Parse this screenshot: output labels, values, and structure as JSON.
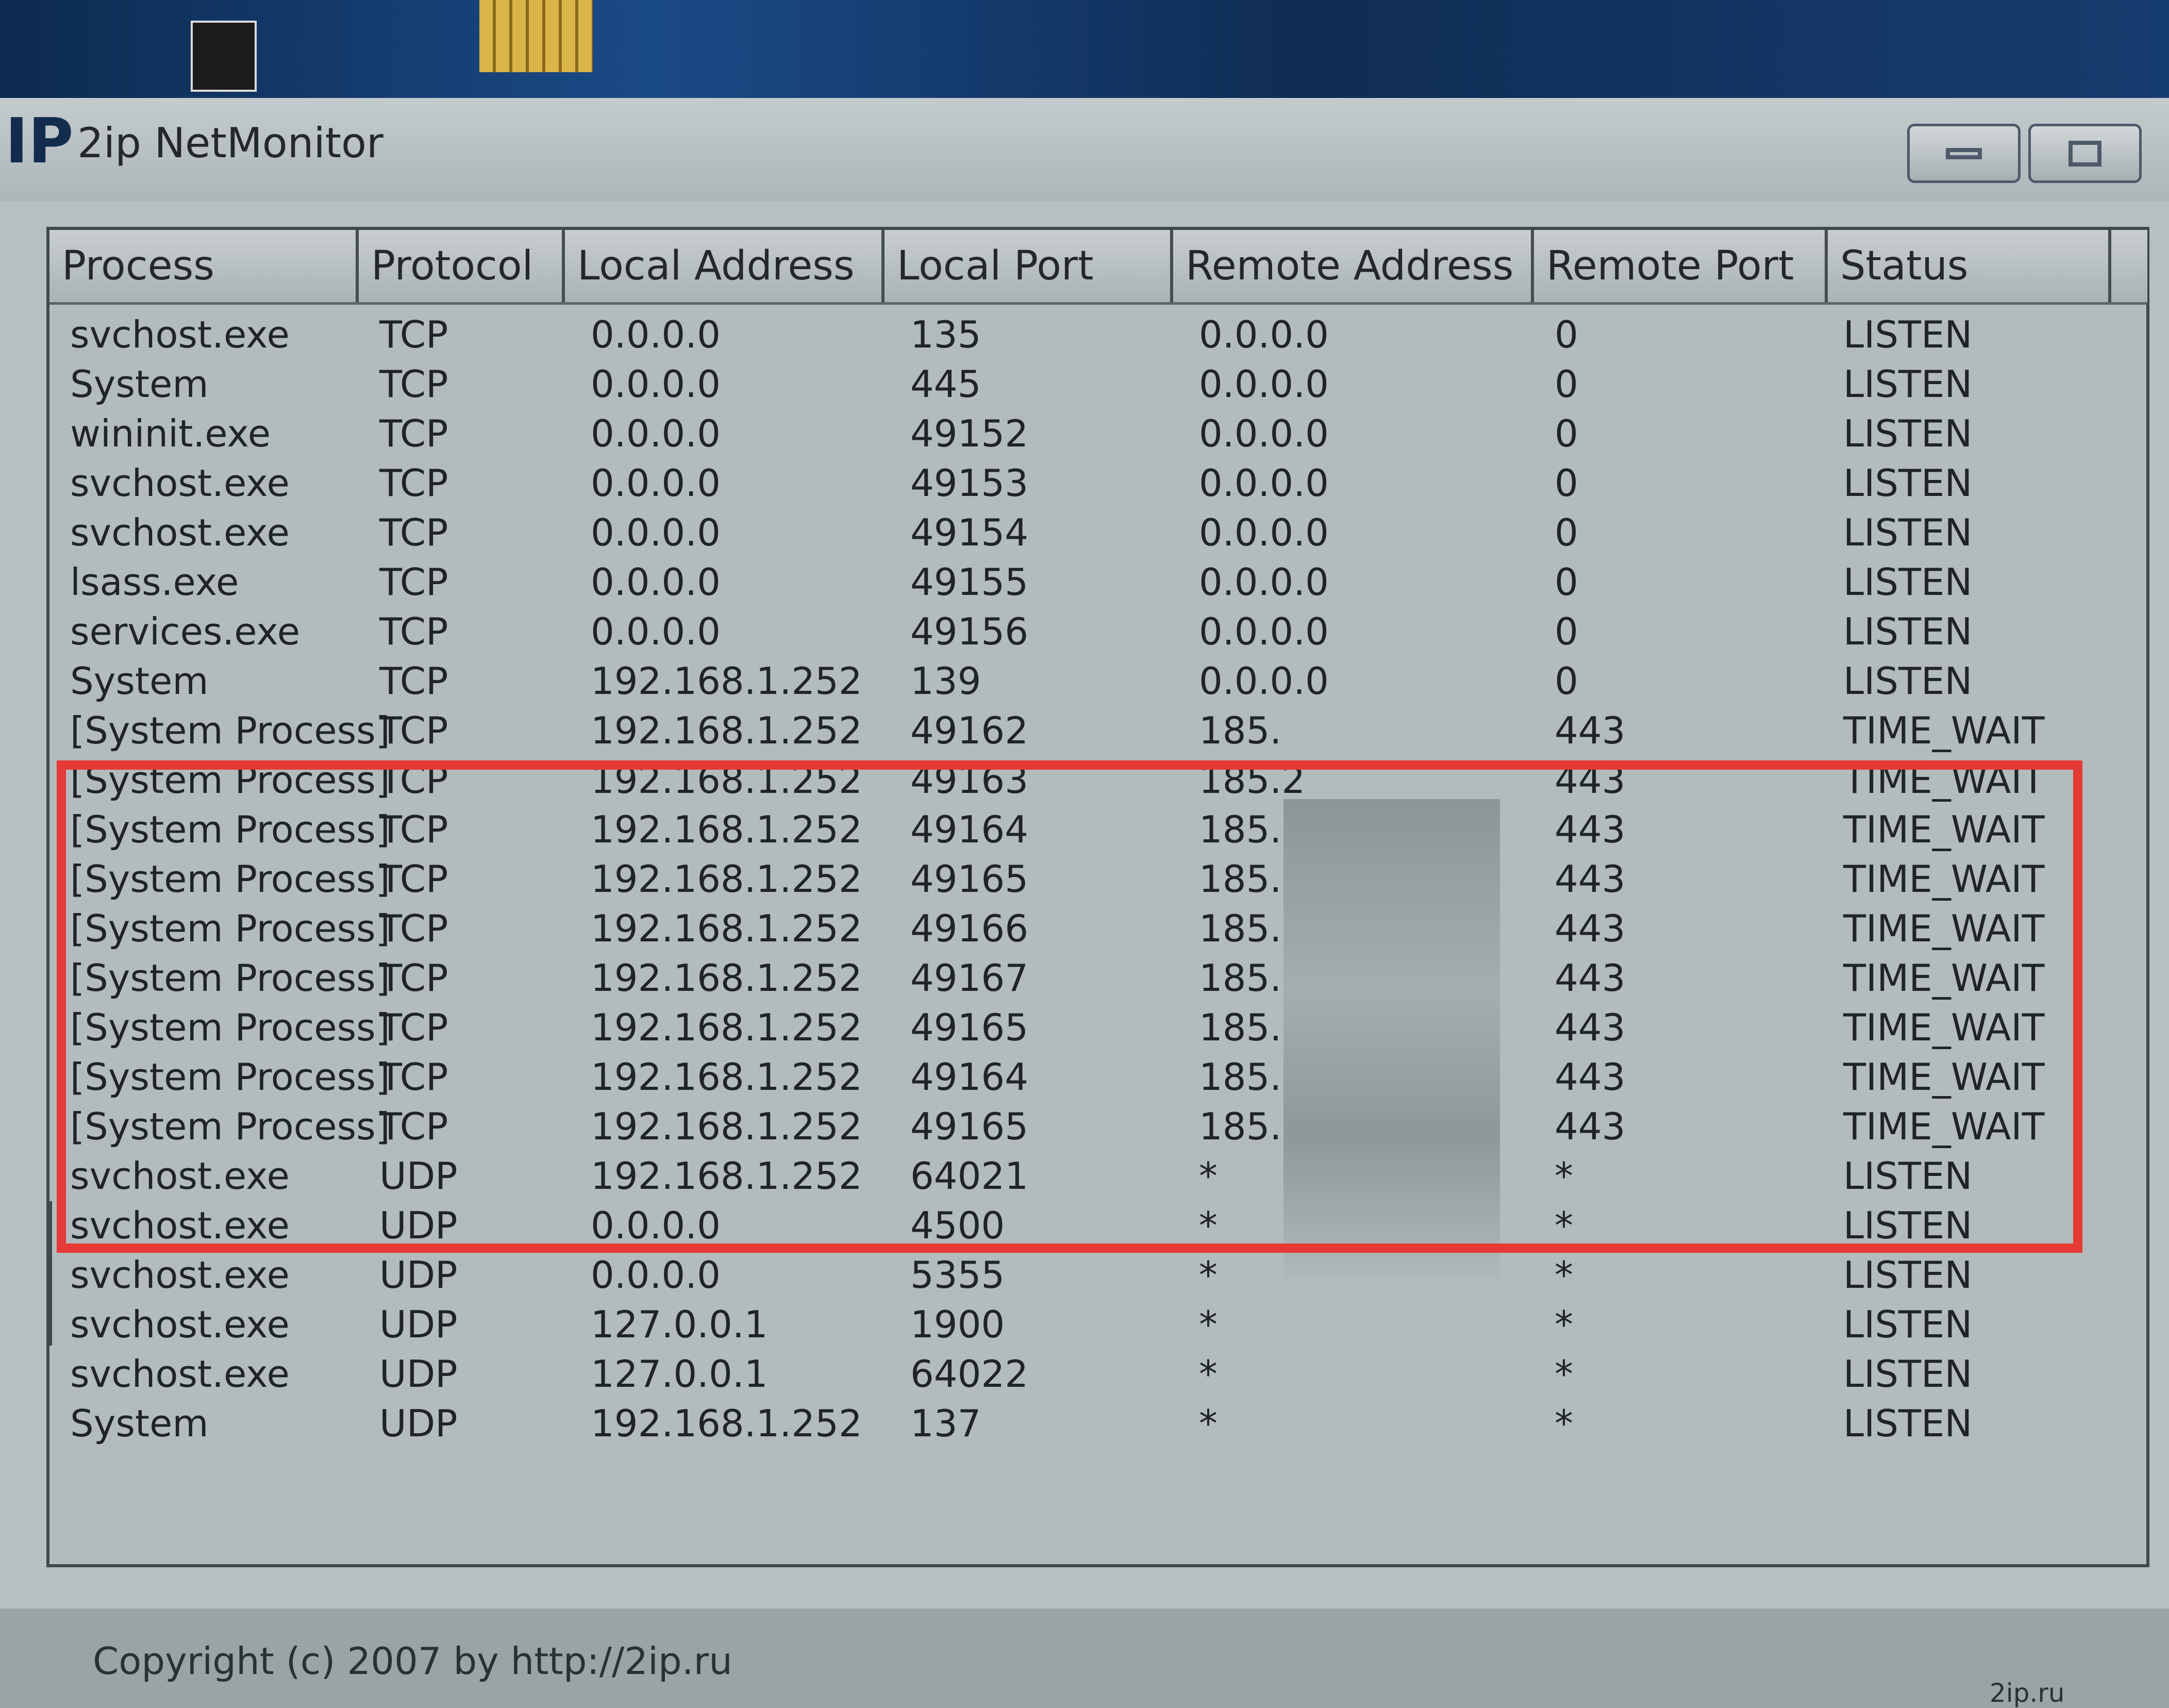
{
  "window": {
    "logo": "IP",
    "title": "2ip NetMonitor"
  },
  "columns": [
    "Process",
    "Protocol",
    "Local Address",
    "Local Port",
    "Remote Address",
    "Remote Port",
    "Status"
  ],
  "rows": [
    [
      "svchost.exe",
      "TCP",
      "0.0.0.0",
      "135",
      "0.0.0.0",
      "0",
      "LISTEN"
    ],
    [
      "System",
      "TCP",
      "0.0.0.0",
      "445",
      "0.0.0.0",
      "0",
      "LISTEN"
    ],
    [
      "wininit.exe",
      "TCP",
      "0.0.0.0",
      "49152",
      "0.0.0.0",
      "0",
      "LISTEN"
    ],
    [
      "svchost.exe",
      "TCP",
      "0.0.0.0",
      "49153",
      "0.0.0.0",
      "0",
      "LISTEN"
    ],
    [
      "svchost.exe",
      "TCP",
      "0.0.0.0",
      "49154",
      "0.0.0.0",
      "0",
      "LISTEN"
    ],
    [
      "lsass.exe",
      "TCP",
      "0.0.0.0",
      "49155",
      "0.0.0.0",
      "0",
      "LISTEN"
    ],
    [
      "services.exe",
      "TCP",
      "0.0.0.0",
      "49156",
      "0.0.0.0",
      "0",
      "LISTEN"
    ],
    [
      "System",
      "TCP",
      "192.168.1.252",
      "139",
      "0.0.0.0",
      "0",
      "LISTEN"
    ],
    [
      "[System Process]",
      "TCP",
      "192.168.1.252",
      "49162",
      "185.",
      "443",
      "TIME_WAIT"
    ],
    [
      "[System Process]",
      "TCP",
      "192.168.1.252",
      "49163",
      "185.2",
      "443",
      "TIME_WAIT"
    ],
    [
      "[System Process]",
      "TCP",
      "192.168.1.252",
      "49164",
      "185.2",
      "443",
      "TIME_WAIT"
    ],
    [
      "[System Process]",
      "TCP",
      "192.168.1.252",
      "49165",
      "185.2",
      "443",
      "TIME_WAIT"
    ],
    [
      "[System Process]",
      "TCP",
      "192.168.1.252",
      "49166",
      "185.2.",
      "443",
      "TIME_WAIT"
    ],
    [
      "[System Process]",
      "TCP",
      "192.168.1.252",
      "49167",
      "185.2",
      "443",
      "TIME_WAIT"
    ],
    [
      "[System Process]",
      "TCP",
      "192.168.1.252",
      "49165",
      "185.2",
      "443",
      "TIME_WAIT"
    ],
    [
      "[System Process]",
      "TCP",
      "192.168.1.252",
      "49164",
      "185.2",
      "443",
      "TIME_WAIT"
    ],
    [
      "[System Process]",
      "TCP",
      "192.168.1.252",
      "49165",
      "185.2.",
      "443",
      "TIME_WAIT"
    ],
    [
      "svchost.exe",
      "UDP",
      "192.168.1.252",
      "64021",
      "*",
      "*",
      "LISTEN"
    ],
    [
      "svchost.exe",
      "UDP",
      "0.0.0.0",
      "4500",
      "*",
      "*",
      "LISTEN"
    ],
    [
      "svchost.exe",
      "UDP",
      "0.0.0.0",
      "5355",
      "*",
      "*",
      "LISTEN"
    ],
    [
      "svchost.exe",
      "UDP",
      "127.0.0.1",
      "1900",
      "*",
      "*",
      "LISTEN"
    ],
    [
      "svchost.exe",
      "UDP",
      "127.0.0.1",
      "64022",
      "*",
      "*",
      "LISTEN"
    ],
    [
      "System",
      "UDP",
      "192.168.1.252",
      "137",
      "*",
      "*",
      "LISTEN"
    ]
  ],
  "footer": {
    "copyright": "Copyright (c) 2007 by http://2ip.ru",
    "corner_logo": "2ip.ru"
  },
  "colors": {
    "highlight": "#e53a36",
    "window_bg": "#b7bfc1"
  }
}
